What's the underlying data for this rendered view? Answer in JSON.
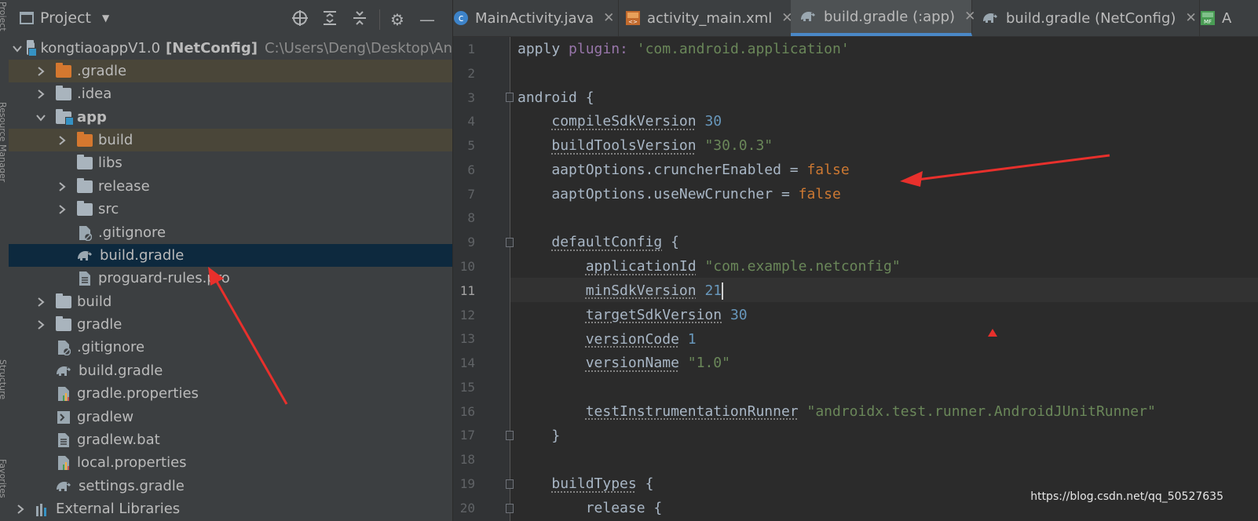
{
  "tool_strip": {
    "labels": [
      "Project",
      "Resource Manager",
      "Structure",
      "Favorites"
    ]
  },
  "project_panel": {
    "title": "Project",
    "tree": [
      {
        "label": "kongtiaoappV1.0",
        "suffix": "[NetConfig]",
        "path": "C:\\Users\\Deng\\Desktop\\An",
        "icon": "module-folder-icon",
        "expanded": true
      },
      {
        "label": ".gradle",
        "icon": "folder-icon",
        "color": "orange",
        "expanded": false
      },
      {
        "label": ".idea",
        "icon": "folder-icon",
        "expanded": false
      },
      {
        "label": "app",
        "icon": "module-folder-icon",
        "expanded": true
      },
      {
        "label": "build",
        "icon": "folder-icon",
        "color": "orange",
        "expanded": false
      },
      {
        "label": "libs",
        "icon": "folder-icon"
      },
      {
        "label": "release",
        "icon": "folder-icon",
        "expanded": false
      },
      {
        "label": "src",
        "icon": "folder-icon",
        "expanded": false
      },
      {
        "label": ".gitignore",
        "icon": "gitignore-file-icon"
      },
      {
        "label": "build.gradle",
        "icon": "gradle-elephant-icon",
        "selected": true
      },
      {
        "label": "proguard-rules.pro",
        "icon": "text-file-icon"
      },
      {
        "label": "build",
        "icon": "folder-icon",
        "expanded": false
      },
      {
        "label": "gradle",
        "icon": "folder-icon",
        "expanded": false
      },
      {
        "label": ".gitignore",
        "icon": "gitignore-file-icon"
      },
      {
        "label": "build.gradle",
        "icon": "gradle-elephant-icon"
      },
      {
        "label": "gradle.properties",
        "icon": "properties-file-icon"
      },
      {
        "label": "gradlew",
        "icon": "shell-file-icon"
      },
      {
        "label": "gradlew.bat",
        "icon": "text-file-icon"
      },
      {
        "label": "local.properties",
        "icon": "properties-file-icon"
      },
      {
        "label": "settings.gradle",
        "icon": "gradle-elephant-icon"
      },
      {
        "label": "External Libraries",
        "icon": "libraries-icon",
        "expanded": false
      }
    ]
  },
  "tabs": [
    {
      "label": "MainActivity.java",
      "icon": "java-class-icon"
    },
    {
      "label": "activity_main.xml",
      "icon": "xml-layout-icon"
    },
    {
      "label": "build.gradle (:app)",
      "icon": "gradle-elephant-icon",
      "active": true
    },
    {
      "label": "build.gradle (NetConfig)",
      "icon": "gradle-elephant-icon"
    },
    {
      "label": "A",
      "icon": "manifest-icon"
    }
  ],
  "editor": {
    "current_line": 11,
    "line_numbers": [
      "1",
      "2",
      "3",
      "4",
      "5",
      "6",
      "7",
      "8",
      "9",
      "10",
      "11",
      "12",
      "13",
      "14",
      "15",
      "16",
      "17",
      "18",
      "19",
      "20"
    ],
    "code_lines": [
      "apply plugin: 'com.android.application'",
      "",
      "android {",
      "    compileSdkVersion 30",
      "    buildToolsVersion \"30.0.3\"",
      "    aaptOptions.cruncherEnabled = false",
      "    aaptOptions.useNewCruncher = false",
      "",
      "    defaultConfig {",
      "        applicationId \"com.example.netconfig\"",
      "        minSdkVersion 21",
      "        targetSdkVersion 30",
      "        versionCode 1",
      "        versionName \"1.0\"",
      "",
      "        testInstrumentationRunner \"androidx.test.runner.AndroidJUnitRunner\"",
      "    }",
      "",
      "    buildTypes {",
      "        release {"
    ]
  },
  "watermark": "https://blog.csdn.net/qq_50527635",
  "colors": {
    "keyword": "#cc7832",
    "string": "#6a8759",
    "number": "#6897bb",
    "annotation_arrow": "#e8302c",
    "selection": "#0d293e"
  }
}
